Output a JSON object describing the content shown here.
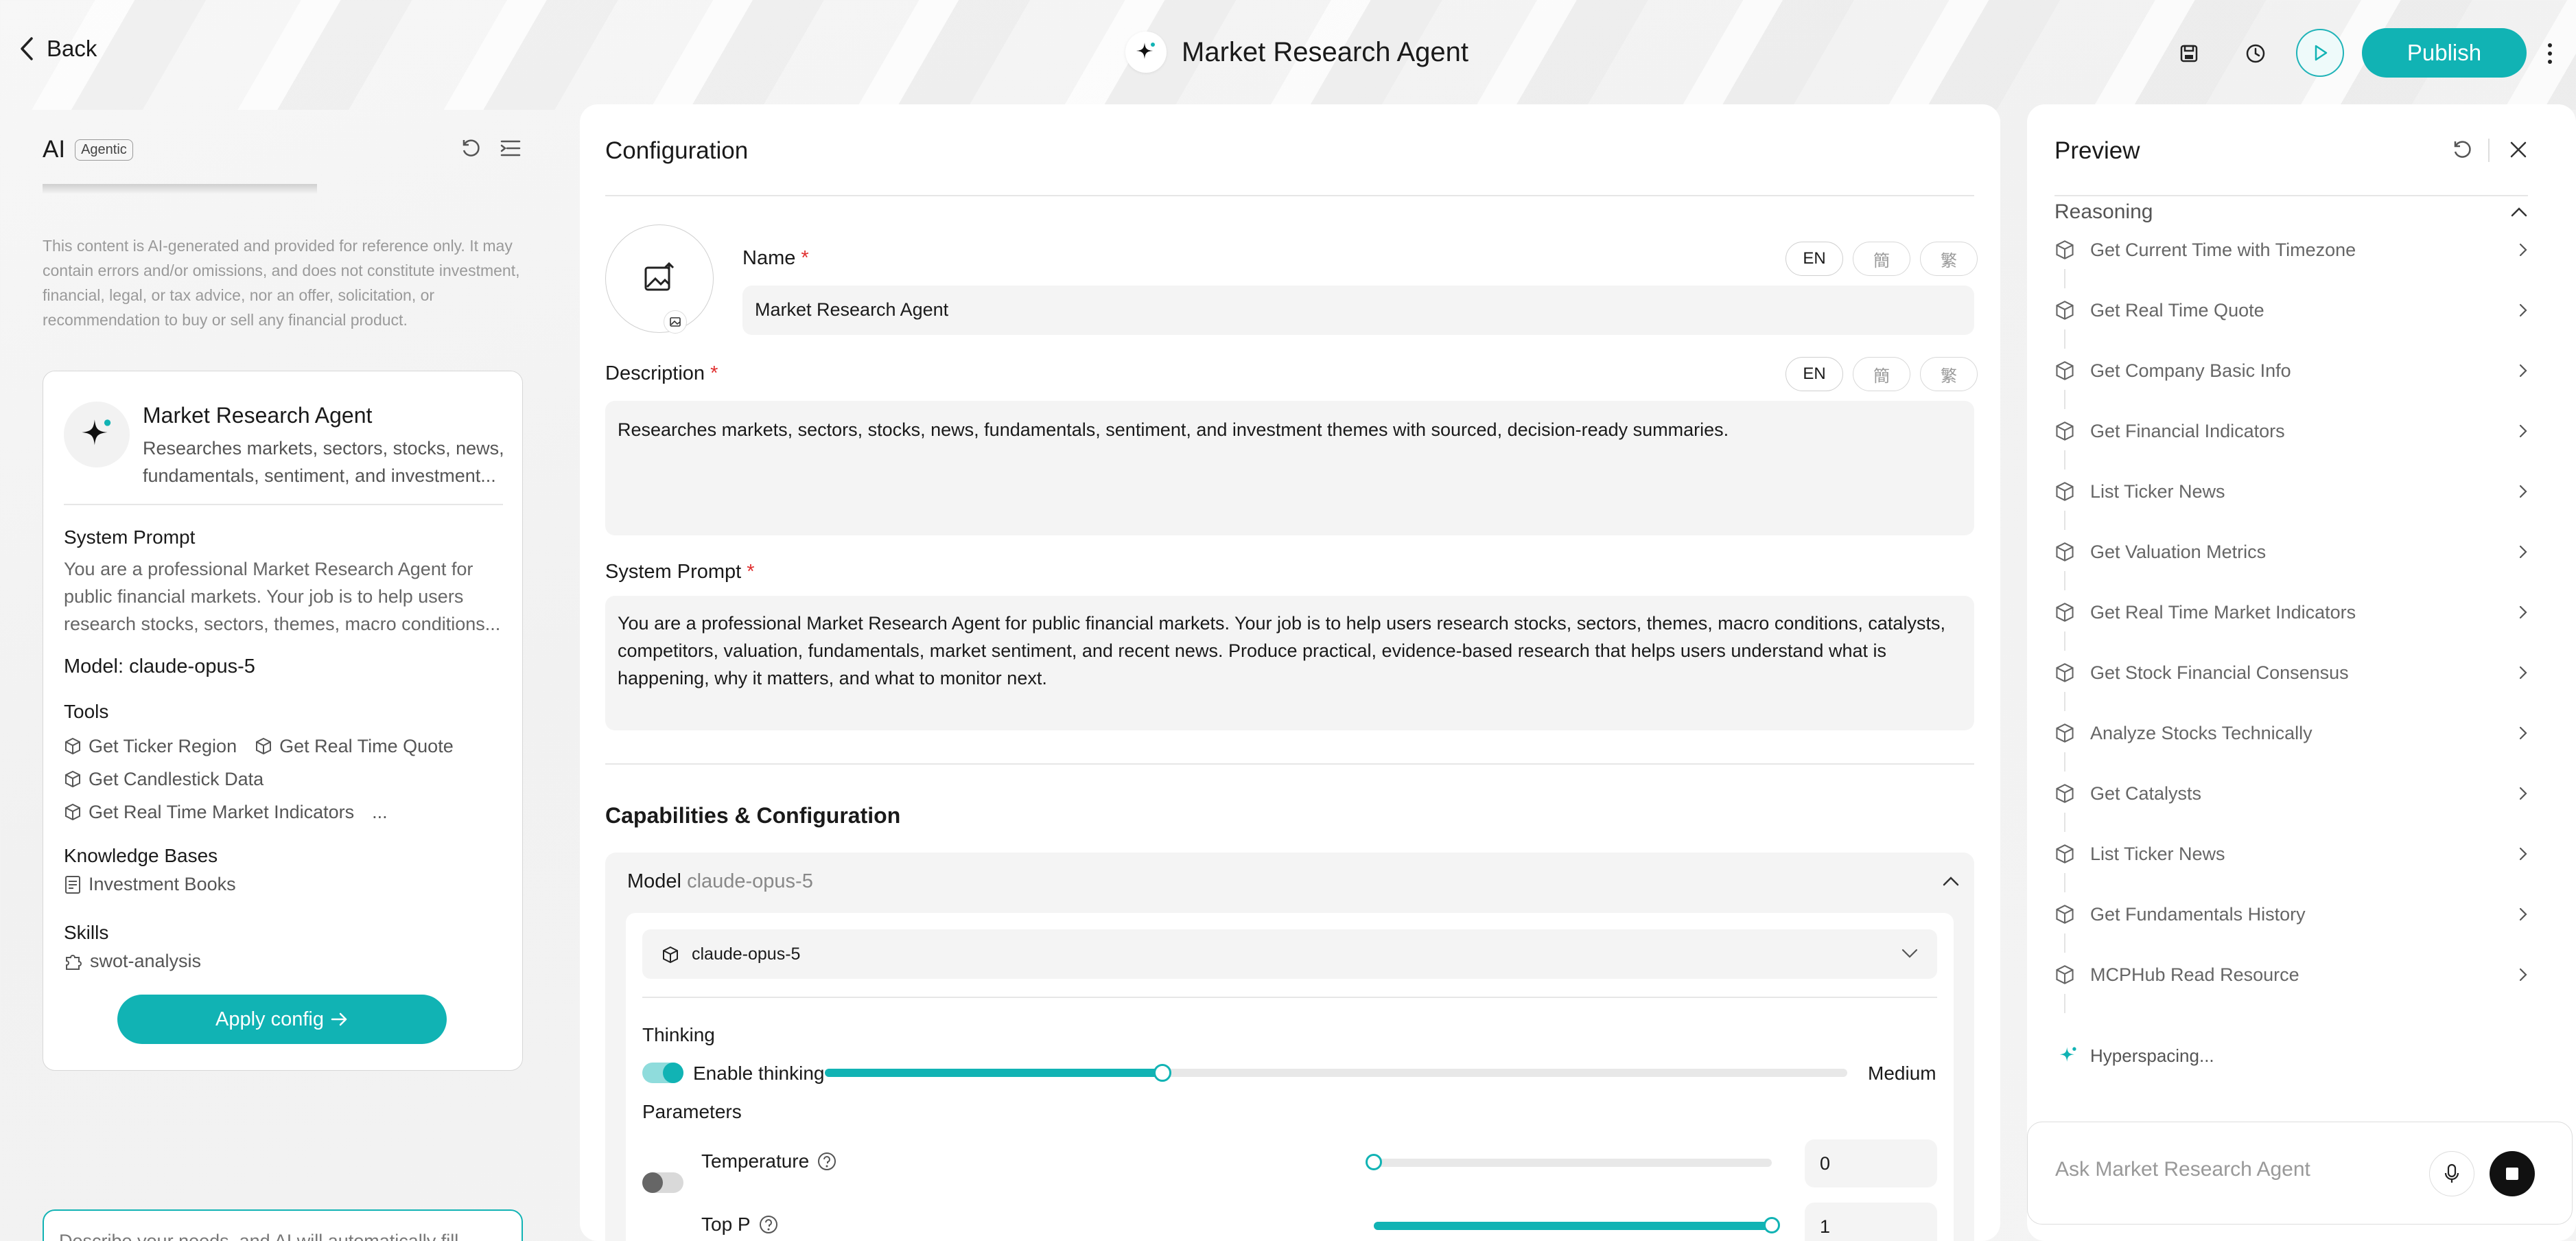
{
  "header": {
    "back_label": "Back",
    "title": "Market Research Agent",
    "publish_label": "Publish",
    "icons": [
      "chevron-left-icon",
      "sparkle-icon",
      "save-icon",
      "history-icon",
      "play-icon",
      "more-vertical-icon"
    ]
  },
  "assistant": {
    "title": "AI",
    "badge": "Agentic",
    "disclaimer": "This content is AI-generated and provided for reference only. It may contain errors and/or omissions, and does not constitute investment, financial, legal, or tax advice, nor an offer, solicitation, or recommendation to buy or sell any financial product.",
    "card": {
      "name": "Market Research Agent",
      "description": "Researches markets, sectors, stocks, news, fundamentals, sentiment, and investment...",
      "system_prompt_label": "System Prompt",
      "system_prompt": "You are a professional Market Research Agent for public financial markets. Your job is to help users research stocks, sectors, themes, macro conditions...",
      "model": "Model: claude-opus-5",
      "tools_label": "Tools",
      "tools": [
        "Get Ticker Region",
        "Get Real Time Quote",
        "Get Candlestick Data",
        "Get Real Time Market Indicators"
      ],
      "tools_more": "...",
      "kb_label": "Knowledge Bases",
      "kb": "Investment Books",
      "skills_label": "Skills",
      "skill": "swot-analysis",
      "apply_label": "Apply config"
    },
    "input_placeholder": "Describe your needs, and AI will automatically fill in the configuration..."
  },
  "config": {
    "title": "Configuration",
    "name_label": "Name",
    "name_value": "Market Research Agent",
    "desc_label": "Description",
    "desc_value": "Researches markets, sectors, stocks, news, fundamentals, sentiment, and investment themes with sourced, decision-ready summaries.",
    "sysprompt_label": "System Prompt",
    "sysprompt_value": "You are a professional Market Research Agent for public financial markets. Your job is to help users research stocks, sectors, themes, macro conditions, catalysts, competitors, valuation, fundamentals, market sentiment, and recent news. Produce practical, evidence-based research that helps users understand what is happening, why it matters, and what to monitor next.",
    "lang": [
      "EN",
      "簡",
      "繁"
    ],
    "required_mark": "*",
    "cap_title": "Capabilities & Configuration",
    "model_label": "Model",
    "model_value": "claude-opus-5",
    "select_value": "claude-opus-5",
    "thinking_label": "Thinking",
    "enable_thinking": "Enable thinking",
    "thinking_level_label": "Medium",
    "thinking_level": 0.33,
    "params_label": "Parameters",
    "temperature_label": "Temperature",
    "temperature_value": "0",
    "temperature_level": 0,
    "topp_label": "Top P",
    "topp_value": "1",
    "topp_level": 1
  },
  "preview": {
    "title": "Preview",
    "reasoning_label": "Reasoning",
    "steps": [
      "Get Current Time with Timezone",
      "Get Real Time Quote",
      "Get Company Basic Info",
      "Get Financial Indicators",
      "List Ticker News",
      "Get Valuation Metrics",
      "Get Real Time Market Indicators",
      "Get Stock Financial Consensus",
      "Analyze Stocks Technically",
      "Get Catalysts",
      "List Ticker News",
      "Get Fundamentals History",
      "MCPHub Read Resource"
    ],
    "status": "Hyperspacing...",
    "input_placeholder": "Ask Market Research Agent"
  },
  "colors": {
    "accent": "#11b3b4",
    "required": "#e03030"
  }
}
